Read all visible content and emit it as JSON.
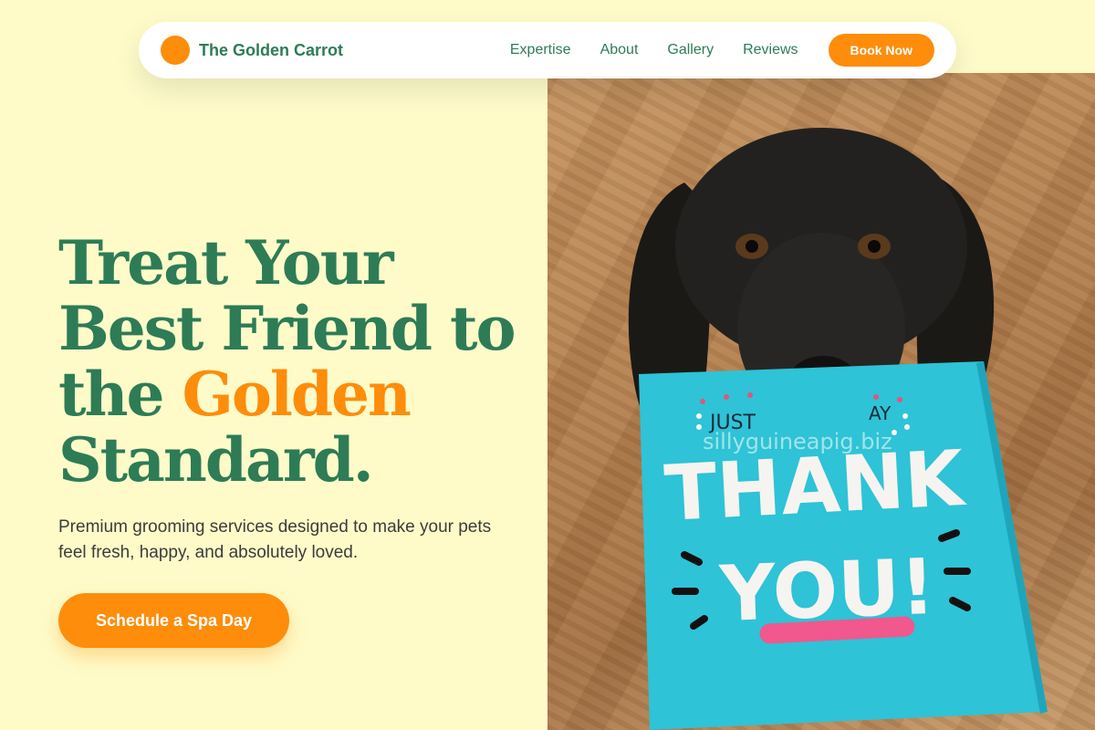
{
  "nav": {
    "brand": "The Golden Carrot",
    "links": [
      "Expertise",
      "About",
      "Gallery",
      "Reviews"
    ],
    "cta": "Book Now"
  },
  "hero": {
    "headline_part1": "Treat Your Best Friend to the ",
    "headline_accent": "Golden",
    "headline_part2": " Standard.",
    "subtitle": "Premium grooming services designed to make your pets feel fresh, happy, and absolutely loved.",
    "cta": "Schedule a Spa Day"
  },
  "photo": {
    "card_top": "JUST",
    "card_top_right": "AY",
    "card_line1": "THANK",
    "card_line2": "YOU!",
    "watermark": "sillyguineapig.biz"
  },
  "colors": {
    "background": "#fefbc9",
    "primary_green": "#2d7c56",
    "accent_orange": "#fd8d0b",
    "card_teal": "#2ec3d6"
  }
}
